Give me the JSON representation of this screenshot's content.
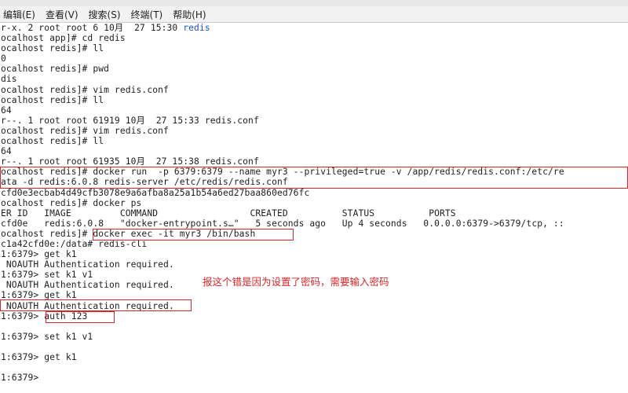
{
  "menu": [
    "编辑(E)",
    "查看(V)",
    "搜索(S)",
    "终端(T)",
    "帮助(H)"
  ],
  "lines": [
    {
      "text": "r-x. 2 root root 6 10月  27 15:30 ",
      "suffix": "redis"
    },
    {
      "text": "ocalhost app]# cd redis"
    },
    {
      "text": "ocalhost redis]# ll"
    },
    {
      "text": "0"
    },
    {
      "text": "ocalhost redis]# pwd"
    },
    {
      "text": "dis"
    },
    {
      "text": "ocalhost redis]# vim redis.conf"
    },
    {
      "text": "ocalhost redis]# ll"
    },
    {
      "text": "64"
    },
    {
      "text": "r--. 1 root root 61919 10月  27 15:33 redis.conf"
    },
    {
      "text": "ocalhost redis]# vim redis.conf"
    },
    {
      "text": "ocalhost redis]# ll"
    },
    {
      "text": "64"
    },
    {
      "text": "r--. 1 root root 61935 10月  27 15:38 redis.conf"
    },
    {
      "text": "ocalhost redis]# docker run  -p 6379:6379 --name myr3 --privileged=true -v /app/redis/redis.conf:/etc/re"
    },
    {
      "text": "ata -d redis:6.0.8 redis-server /etc/redis/redis.conf"
    },
    {
      "text": "cfd0e3ecbab4d49cfb3078e9a6afba8a25a1b54a6ed27baa860ed76fc"
    },
    {
      "text": "ocalhost redis]# docker ps"
    },
    {
      "text": "ER ID   IMAGE         COMMAND                 CREATED          STATUS          PORTS"
    },
    {
      "text": "cfd0e   redis:6.0.8   \"docker-entrypoint.s…\"   5 seconds ago   Up 4 seconds   0.0.0.0:6379->6379/tcp, ::"
    },
    {
      "text": "ocalhost redis]# docker exec -it myr3 /bin/bash"
    },
    {
      "text": "c1a42cfd0e:/data# redis-cli"
    },
    {
      "text": "1:6379> get k1"
    },
    {
      "text": " NOAUTH Authentication required."
    },
    {
      "text": "1:6379> set k1 v1"
    },
    {
      "text": " NOAUTH Authentication required."
    },
    {
      "text": "1:6379> get k1"
    },
    {
      "text": " NOAUTH Authentication required."
    },
    {
      "text": "1:6379> auth 123"
    },
    {
      "text": ""
    },
    {
      "text": "1:6379> set k1 v1"
    },
    {
      "text": ""
    },
    {
      "text": "1:6379> get k1"
    },
    {
      "text": ""
    },
    {
      "text": "1:6379>"
    }
  ],
  "annotation": "报这个错是因为设置了密码，需要输入密码",
  "colors": {
    "highlight": "#d9262a",
    "dir_blue": "#1c4fd6"
  }
}
